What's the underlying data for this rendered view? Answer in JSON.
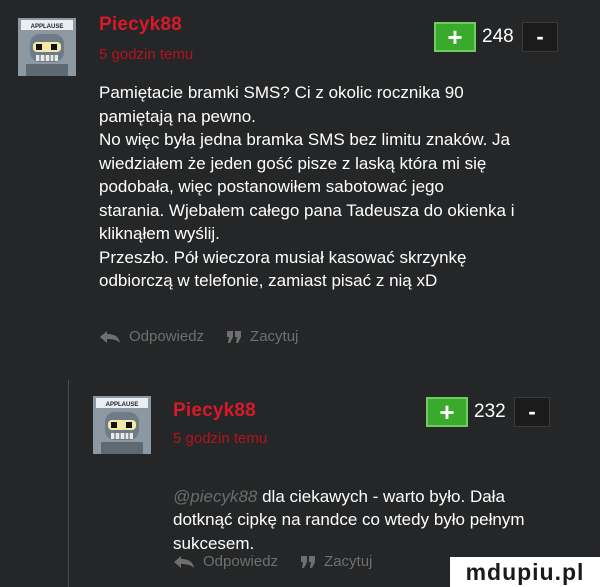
{
  "comments": [
    {
      "author": "Piecyk88",
      "time": "5 godzin temu",
      "vote": {
        "plus": "+",
        "score": "248",
        "minus": "-"
      },
      "text": "Pamiętacie bramki SMS? Ci z okolic rocznika 90\npamiętają na pewno.\nNo więc była jedna bramka SMS bez limitu znaków. Ja\nwiedziałem że jeden gość pisze z laską która mi się\npodobała, więc postanowiłem sabotować jego\nstarania. Wjebałem całego pana Tadeusza do okienka i\nkliknąłem wyślij.\nPrzeszło. Pół wieczora musiał kasować skrzynkę\nodbiorczą w telefonie, zamiast pisać z nią xD",
      "actions": {
        "reply": "Odpowiedz",
        "quote": "Zacytuj"
      },
      "avatar_label": "APPLAUSE"
    },
    {
      "author": "Piecyk88",
      "time": "5 godzin temu",
      "vote": {
        "plus": "+",
        "score": "232",
        "minus": "-"
      },
      "mention": "@piecyk88",
      "text": " dla ciekawych - warto było. Dała\ndotknąć cipkę na randce co wtedy było pełnym\nsukcesem.",
      "actions": {
        "reply": "Odpowiedz",
        "quote": "Zacytuj"
      },
      "avatar_label": "APPLAUSE"
    }
  ],
  "watermark": "mdupiu.pl",
  "colors": {
    "background": "#252627",
    "author": "#d8192a",
    "time": "#b3131f",
    "plus_button": "#3aaa2c",
    "muted": "#6f6f6f"
  },
  "icons": [
    "reply-arrow-icon",
    "quote-icon",
    "plus-icon",
    "minus-icon"
  ]
}
